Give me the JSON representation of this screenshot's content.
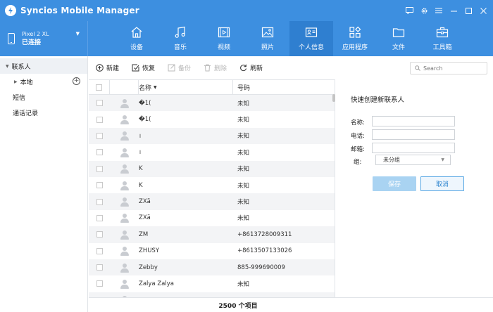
{
  "window": {
    "title": "Syncios Mobile Manager"
  },
  "device": {
    "name": "Pixel 2 XL",
    "status": "已连接"
  },
  "tabs": [
    {
      "label": "设备",
      "icon": "home-icon",
      "active": false
    },
    {
      "label": "音乐",
      "icon": "music-icon",
      "active": false
    },
    {
      "label": "视频",
      "icon": "video-icon",
      "active": false
    },
    {
      "label": "照片",
      "icon": "photo-icon",
      "active": false
    },
    {
      "label": "个人信息",
      "icon": "contact-card-icon",
      "active": true
    },
    {
      "label": "应用程序",
      "icon": "apps-icon",
      "active": false
    },
    {
      "label": "文件",
      "icon": "folder-icon",
      "active": false
    },
    {
      "label": "工具箱",
      "icon": "toolbox-icon",
      "active": false
    }
  ],
  "sidebar": {
    "group": "联系人",
    "sub_item": "本地",
    "items": [
      "短信",
      "通话记录"
    ]
  },
  "toolbar": {
    "new_label": "新建",
    "restore_label": "恢复",
    "backup_label": "备份",
    "delete_label": "删除",
    "refresh_label": "刷新",
    "search_placeholder": "Search"
  },
  "table": {
    "col_name": "名称",
    "col_phone": "号码",
    "rows": [
      {
        "name": "�1(",
        "phone": "未知"
      },
      {
        "name": "�1(",
        "phone": "未知"
      },
      {
        "name": "।",
        "phone": "未知"
      },
      {
        "name": "।",
        "phone": "未知"
      },
      {
        "name": "K",
        "phone": "未知"
      },
      {
        "name": "K",
        "phone": "未知"
      },
      {
        "name": "ZXä",
        "phone": "未知"
      },
      {
        "name": "ZXä",
        "phone": "未知"
      },
      {
        "name": "ZM",
        "phone": "+8613728009311"
      },
      {
        "name": "ZHUSY",
        "phone": "+8613507133026"
      },
      {
        "name": "Zebby",
        "phone": "885-999690009"
      },
      {
        "name": "Zalya Zalya",
        "phone": "未知"
      },
      {
        "name": "",
        "phone": ""
      }
    ]
  },
  "status": {
    "count_text": "2500 个项目"
  },
  "panel": {
    "title": "快速创建新联系人",
    "name_label": "名称:",
    "phone_label": "电话:",
    "email_label": "邮箱:",
    "group_label": "组:",
    "group_value": "未分组",
    "save_label": "保存",
    "cancel_label": "取消"
  },
  "colors": {
    "accent": "#3d8fe0",
    "active_tab": "#2f7fd0",
    "save_disabled": "#a9d3f2"
  }
}
